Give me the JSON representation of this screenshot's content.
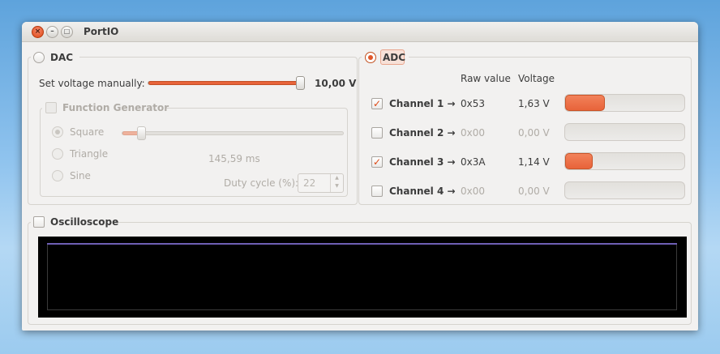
{
  "window": {
    "title": "PortIO"
  },
  "dac": {
    "label": "DAC",
    "selected": false,
    "set_voltage_label": "Set voltage manually:",
    "voltage_value": "10,00 V",
    "voltage_slider_fraction": 1.0,
    "function_generator": {
      "label": "Function Generator",
      "checked": false,
      "waveforms": [
        {
          "label": "Square",
          "selected": true
        },
        {
          "label": "Triangle",
          "selected": false
        },
        {
          "label": "Sine",
          "selected": false
        }
      ],
      "period_slider_fraction": 0.09,
      "period_text": "145,59 ms",
      "duty_cycle_label": "Duty cycle (%):",
      "duty_cycle_value": "22"
    }
  },
  "adc": {
    "label": "ADC",
    "selected": true,
    "raw_value_header": "Raw value",
    "voltage_header": "Voltage",
    "channels": [
      {
        "label": "Channel 1 →",
        "checked": true,
        "raw": "0x53",
        "voltage": "1,63 V",
        "level": 0.33
      },
      {
        "label": "Channel 2 →",
        "checked": false,
        "raw": "0x00",
        "voltage": "0,00 V",
        "level": 0
      },
      {
        "label": "Channel 3 →",
        "checked": true,
        "raw": "0x3A",
        "voltage": "1,14 V",
        "level": 0.23
      },
      {
        "label": "Channel 4 →",
        "checked": false,
        "raw": "0x00",
        "voltage": "0,00 V",
        "level": 0
      }
    ],
    "accent_color": "#e8633a"
  },
  "oscilloscope": {
    "label": "Oscilloscope",
    "checked": false,
    "trace_color": "#6e5fb5"
  }
}
